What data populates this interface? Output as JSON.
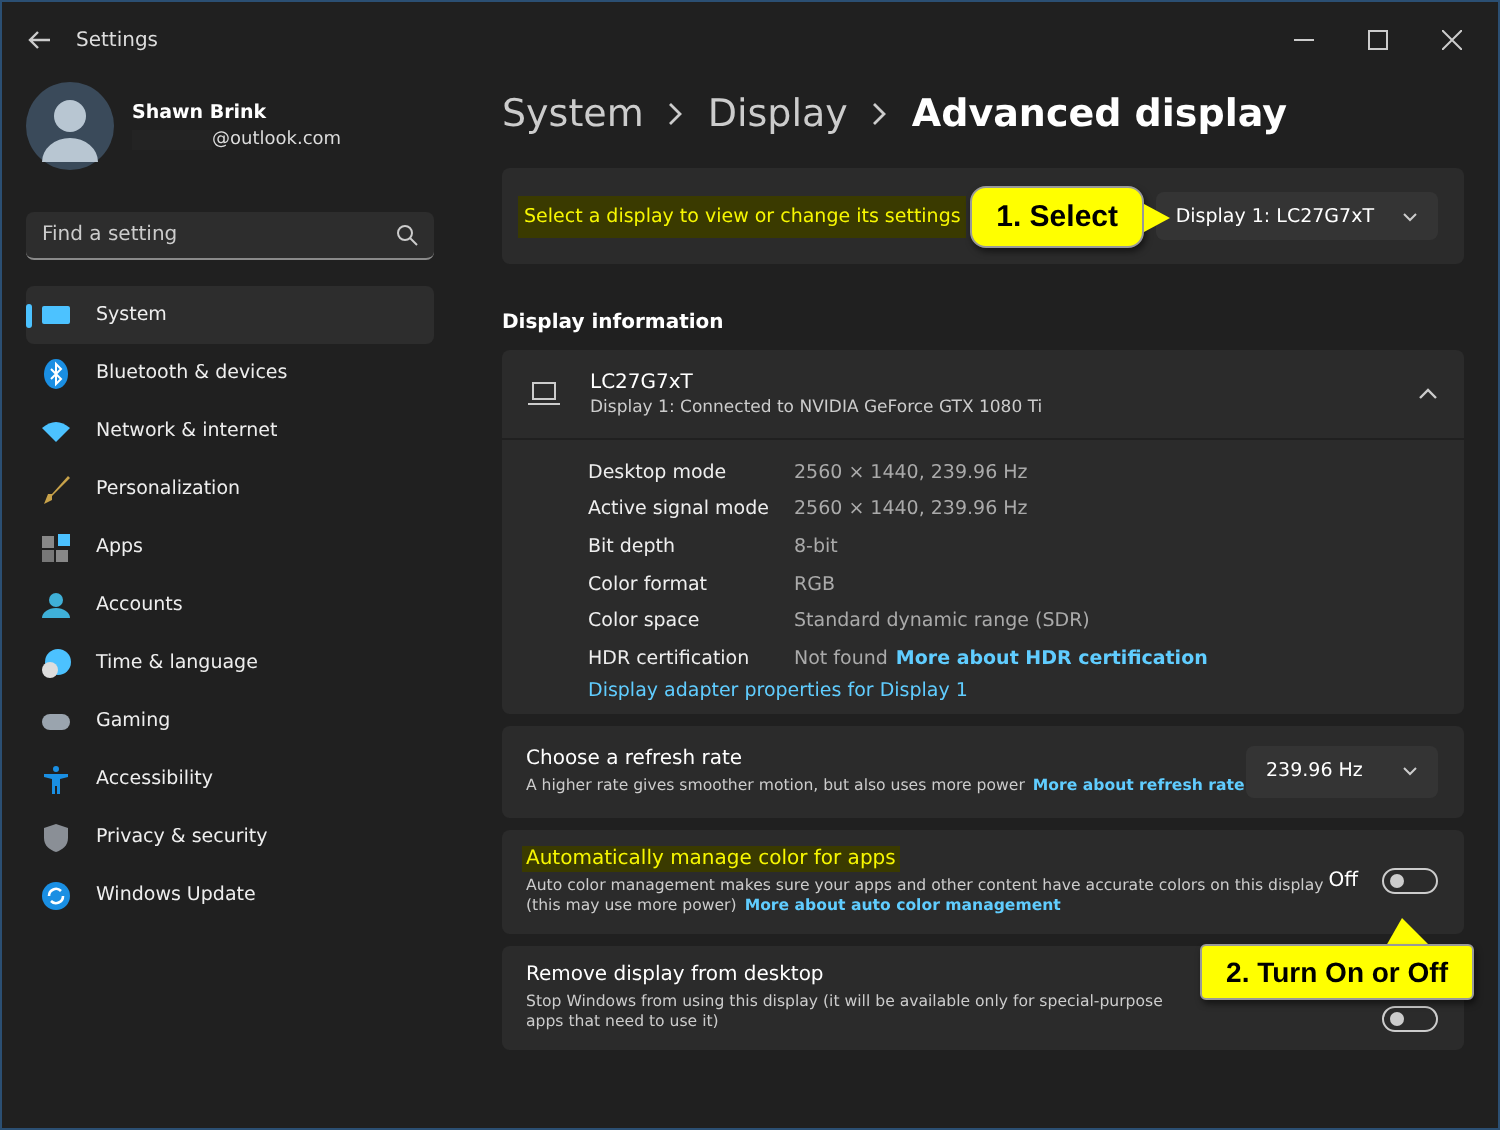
{
  "window": {
    "title": "Settings"
  },
  "account": {
    "name": "Shawn Brink",
    "email": "@outlook.com"
  },
  "search": {
    "placeholder": "Find a setting"
  },
  "sidebar": {
    "items": [
      {
        "label": "System",
        "selected": true
      },
      {
        "label": "Bluetooth & devices",
        "selected": false
      },
      {
        "label": "Network & internet",
        "selected": false
      },
      {
        "label": "Personalization",
        "selected": false
      },
      {
        "label": "Apps",
        "selected": false
      },
      {
        "label": "Accounts",
        "selected": false
      },
      {
        "label": "Time & language",
        "selected": false
      },
      {
        "label": "Gaming",
        "selected": false
      },
      {
        "label": "Accessibility",
        "selected": false
      },
      {
        "label": "Privacy & security",
        "selected": false
      },
      {
        "label": "Windows Update",
        "selected": false
      }
    ]
  },
  "breadcrumb": [
    "System",
    "Display",
    "Advanced display"
  ],
  "display_select": {
    "label": "Select a display to view or change its settings",
    "highlighted": true,
    "value": "Display 1: LC27G7xT"
  },
  "display_information": {
    "heading": "Display information",
    "name": "LC27G7xT",
    "subtitle": "Display 1: Connected to NVIDIA GeForce GTX 1080 Ti",
    "expanded": true,
    "rows": [
      {
        "label": "Desktop mode",
        "value": "2560 × 1440, 239.96 Hz"
      },
      {
        "label": "Active signal mode",
        "value": "2560 × 1440, 239.96 Hz"
      },
      {
        "label": "Bit depth",
        "value": "8-bit"
      },
      {
        "label": "Color format",
        "value": "RGB"
      },
      {
        "label": "Color space",
        "value": "Standard dynamic range (SDR)"
      },
      {
        "label": "HDR certification",
        "value": "Not found",
        "link": "More about HDR certification"
      }
    ],
    "adapter_link": "Display adapter properties for Display 1"
  },
  "settings": [
    {
      "kind": "dropdown",
      "title": "Choose a refresh rate",
      "highlighted": false,
      "description": "A higher rate gives smoother motion, but also uses more power",
      "link": "More about refresh rate",
      "value": "239.96 Hz"
    },
    {
      "kind": "toggle",
      "title": "Automatically manage color for apps",
      "highlighted": true,
      "description": "Auto color management makes sure your apps and other content have accurate colors on this display (this may use more power)",
      "link": "More about auto color management",
      "state_label": "Off",
      "on": false
    },
    {
      "kind": "toggle",
      "title": "Remove display from desktop",
      "highlighted": false,
      "description": "Stop Windows from using this display (it will be available only for special-purpose apps that need to use it)",
      "on": false
    }
  ],
  "annotations": [
    {
      "text": "1. Select"
    },
    {
      "text": "2. Turn On or Off"
    }
  ]
}
